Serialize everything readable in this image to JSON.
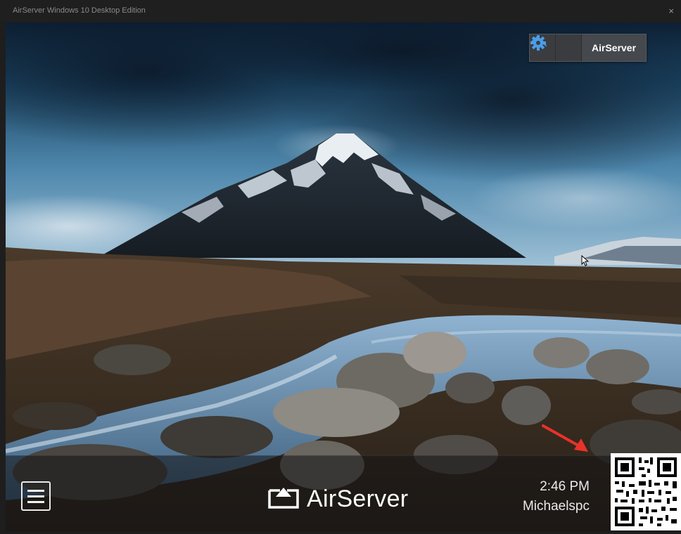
{
  "window": {
    "title": "AirServer Windows 10 Desktop Edition",
    "close_glyph": "×"
  },
  "toolbar": {
    "back_icon": "back-arrow-icon",
    "settings_icon": "gear-icon",
    "label": "AirServer",
    "accent": "#4a9ee8"
  },
  "background": {
    "description_icon": "mountain-river-wallpaper"
  },
  "bottom_bar": {
    "menu_icon": "hamburger-menu-icon",
    "brand_icon": "airplay-icon",
    "brand_name": "AirServer",
    "time": "2:46 PM",
    "computer_name": "Michaelspc",
    "qr_icon": "qr-code-icon",
    "annotation_arrow_color": "#e8322b"
  }
}
